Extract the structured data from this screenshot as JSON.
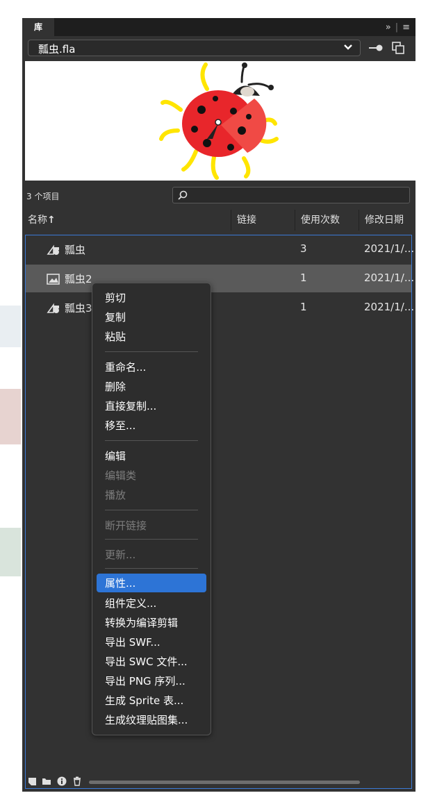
{
  "panel": {
    "tab_title": "库",
    "tab_overflow": "»",
    "menu_glyph": "≡"
  },
  "file": {
    "name": "瓢虫.fla"
  },
  "library": {
    "item_count": "3 个项目",
    "columns": [
      "名称",
      "链接",
      "使用次数",
      "修改日期"
    ],
    "sort_arrow": "↑",
    "items": [
      {
        "name": "瓢虫",
        "uses": "3",
        "date": "2021/1/..."
      },
      {
        "name": "瓢虫2",
        "uses": "1",
        "date": "2021/1/..."
      },
      {
        "name": "瓢虫3",
        "uses": "1",
        "date": "2021/1/..."
      }
    ]
  },
  "context_menu": {
    "g1": [
      "剪切",
      "复制",
      "粘贴"
    ],
    "g2": [
      "重命名...",
      "删除",
      "直接复制...",
      "移至..."
    ],
    "g3": [
      "编辑",
      "编辑类",
      "播放"
    ],
    "g4": [
      "断开链接"
    ],
    "g5": [
      "更新..."
    ],
    "g6": [
      "属性...",
      "组件定义...",
      "转换为编译剪辑",
      "导出 SWF...",
      "导出 SWC 文件...",
      "导出 PNG 序列...",
      "生成 Sprite 表...",
      "生成纹理贴图集..."
    ]
  },
  "colors": {
    "panel_bg": "#323232",
    "selection": "#2d74d6",
    "list_border": "#3b7ad7",
    "ladybug_red": "#e8262b",
    "leg_yellow": "#ffe500"
  }
}
